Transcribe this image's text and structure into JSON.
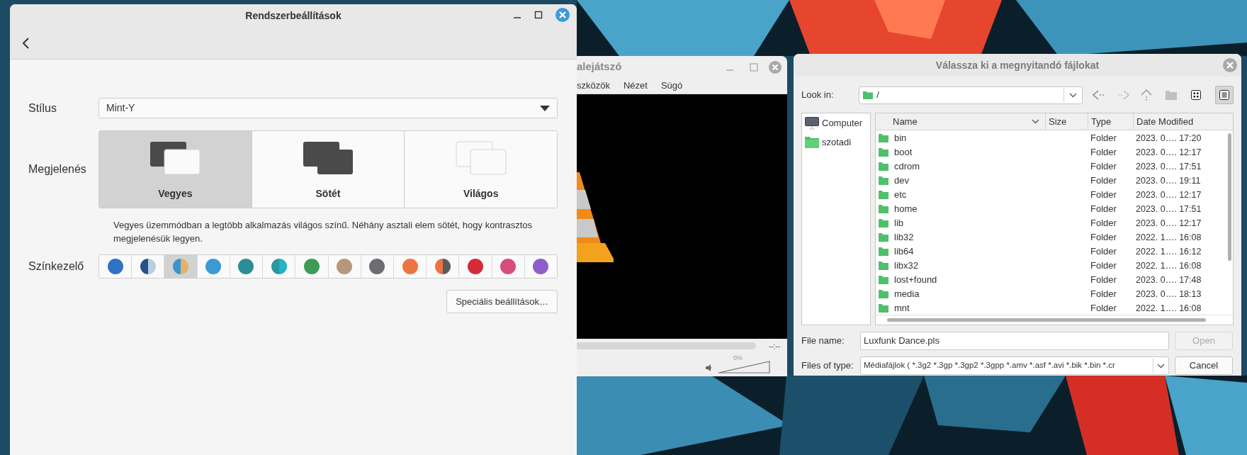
{
  "settings_window": {
    "title": "Rendszerbeállítások",
    "style": {
      "label": "Stílus",
      "value": "Mint-Y"
    },
    "appearance": {
      "label": "Megjelenés",
      "options": [
        {
          "label": "Vegyes",
          "kind": "mixed",
          "selected": true
        },
        {
          "label": "Sötét",
          "kind": "dark",
          "selected": false
        },
        {
          "label": "Világos",
          "kind": "light",
          "selected": false
        }
      ],
      "description": "Vegyes üzemmódban a legtöbb alkalmazás világos színű. Néhány asztali elem sötét, hogy kontrasztos megjelenésük legyen."
    },
    "accent": {
      "label": "Színkezelő",
      "swatches": [
        {
          "kind": "solid",
          "color": "#2f72c6",
          "selected": false
        },
        {
          "kind": "split",
          "halves": [
            {
              "color": "#24528c"
            },
            {
              "color": "#b7cfe0"
            }
          ],
          "selected": false
        },
        {
          "kind": "split",
          "halves": [
            {
              "color": "#3b94d2"
            },
            {
              "color": "#e2b468"
            }
          ],
          "selected": true
        },
        {
          "kind": "solid",
          "color": "#3a9ad5",
          "selected": false
        },
        {
          "kind": "solid",
          "color": "#2a8e98",
          "selected": false
        },
        {
          "kind": "split",
          "halves": [
            {
              "color": "#2c96a0"
            },
            {
              "color": "#20b4c6"
            }
          ],
          "selected": false
        },
        {
          "kind": "solid",
          "color": "#3e9b56",
          "selected": false
        },
        {
          "kind": "solid",
          "color": "#b8977b",
          "selected": false
        },
        {
          "kind": "solid",
          "color": "#6c6d72",
          "selected": false
        },
        {
          "kind": "solid",
          "color": "#ec7442",
          "selected": false
        },
        {
          "kind": "split",
          "halves": [
            {
              "color": "#e97342"
            },
            {
              "color": "#5b5b5b"
            }
          ],
          "selected": false
        },
        {
          "kind": "solid",
          "color": "#d42b36",
          "selected": false
        },
        {
          "kind": "solid",
          "color": "#d94c7c",
          "selected": false
        },
        {
          "kind": "solid",
          "color": "#8b5ec9",
          "selected": false
        }
      ]
    },
    "advanced_button": "Speciális beállítások…"
  },
  "media_player_window": {
    "title": "alejátszó",
    "menu": [
      "szközök",
      "Nézet",
      "Súgó"
    ],
    "time": "--:--",
    "volume": {
      "reading": "0%",
      "level": 0
    }
  },
  "file_dialog": {
    "title": "Válassza ki a megnyitandó fájlokat",
    "look_in": {
      "label": "Look in:",
      "value": "/"
    },
    "view_buttons": [
      {
        "kind": "icons",
        "selected": false
      },
      {
        "kind": "detail",
        "selected": true
      }
    ],
    "places": [
      {
        "label": "Computer",
        "kind": "computer"
      },
      {
        "label": "szotadi",
        "kind": "folder"
      }
    ],
    "columns": [
      "Name",
      "Size",
      "Type",
      "Date Modified"
    ],
    "rows": [
      {
        "name": "bin",
        "type": "Folder",
        "date": "2023. 0…. 17:20"
      },
      {
        "name": "boot",
        "type": "Folder",
        "date": "2023. 0…. 12:17"
      },
      {
        "name": "cdrom",
        "type": "Folder",
        "date": "2023. 0…. 17:51"
      },
      {
        "name": "dev",
        "type": "Folder",
        "date": "2023. 0…. 19:11"
      },
      {
        "name": "etc",
        "type": "Folder",
        "date": "2023. 0…. 12:17"
      },
      {
        "name": "home",
        "type": "Folder",
        "date": "2023. 0…. 17:51"
      },
      {
        "name": "lib",
        "type": "Folder",
        "date": "2023. 0…. 12:17"
      },
      {
        "name": "lib32",
        "type": "Folder",
        "date": "2022. 1…. 16:08"
      },
      {
        "name": "lib64",
        "type": "Folder",
        "date": "2022. 1…. 16:12"
      },
      {
        "name": "libx32",
        "type": "Folder",
        "date": "2022. 1…. 16:08"
      },
      {
        "name": "lost+found",
        "type": "Folder",
        "date": "2023. 0…. 17:48"
      },
      {
        "name": "media",
        "type": "Folder",
        "date": "2023. 0…. 18:13"
      },
      {
        "name": "mnt",
        "type": "Folder",
        "date": "2022. 1…. 16:08"
      }
    ],
    "file_name": {
      "label": "File name:",
      "value": "Luxfunk Dance.pls"
    },
    "file_type": {
      "label": "Files of type:",
      "value": "Médiafájlok ( *.3g2 *.3gp *.3gp2 *.3gpp *.amv *.asf *.avi *.bik *.bin *.cr"
    },
    "buttons": [
      {
        "label": "Open",
        "disabled": true
      },
      {
        "label": "Cancel",
        "disabled": false
      }
    ]
  }
}
